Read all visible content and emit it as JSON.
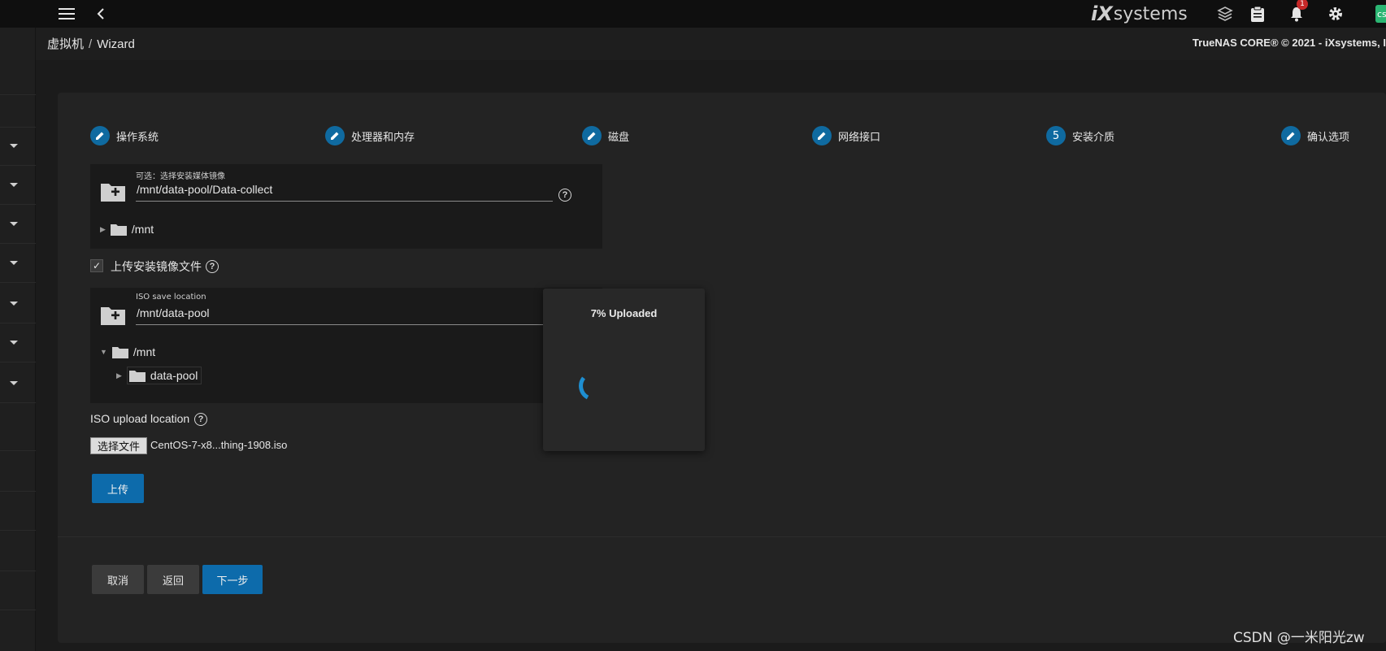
{
  "topbar": {
    "brand_logo": "iX",
    "brand_text": "systems",
    "notification_count": "1",
    "user_initials": "cs"
  },
  "breadcrumb": {
    "parent": "虚拟机",
    "separator": "/",
    "current": "Wizard"
  },
  "copyright": "TrueNAS CORE® © 2021 - iXsystems, I",
  "steps": [
    {
      "label": "操作系统",
      "marker": "edit-icon"
    },
    {
      "label": "处理器和内存",
      "marker": "edit-icon"
    },
    {
      "label": "磁盘",
      "marker": "edit-icon"
    },
    {
      "label": "网络接口",
      "marker": "edit-icon"
    },
    {
      "label": "安装介质",
      "marker": "5"
    },
    {
      "label": "确认选项",
      "marker": "edit-icon"
    }
  ],
  "media_image": {
    "label": "可选：选择安装媒体镜像",
    "value": "/mnt/data-pool/Data-collect",
    "tree_root": "/mnt"
  },
  "upload_checkbox": {
    "label": "上传安装镜像文件",
    "checked": true
  },
  "iso_save": {
    "label": "ISO save location",
    "value": "/mnt/data-pool",
    "tree_root": "/mnt",
    "tree_child": "data-pool"
  },
  "iso_upload": {
    "label": "ISO upload location",
    "file_button": "选择文件",
    "file_name": "CentOS-7-x8...thing-1908.iso"
  },
  "buttons": {
    "upload": "上传",
    "cancel": "取消",
    "back": "返回",
    "next": "下一步"
  },
  "progress_dialog": {
    "title": "7% Uploaded",
    "percent": 7
  },
  "watermark": "CSDN @一米阳光zw",
  "colors": {
    "accent": "#0d6bab",
    "step_dot": "#0f6aa0",
    "spinner": "#1e8ed0"
  }
}
